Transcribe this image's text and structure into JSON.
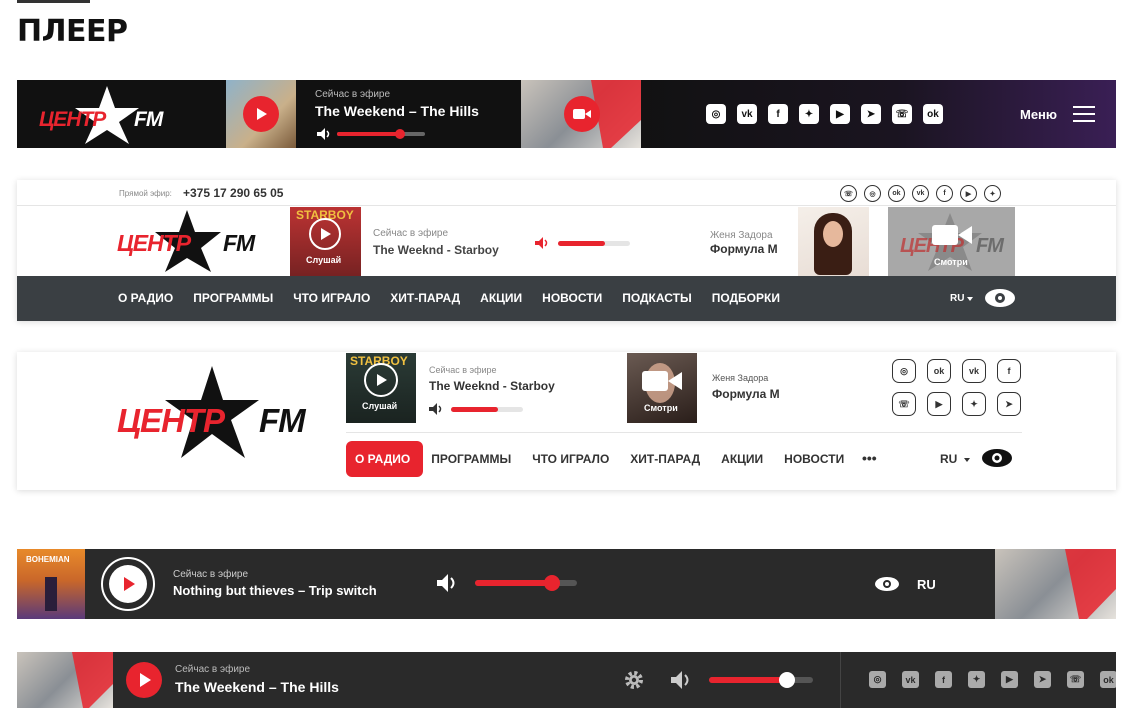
{
  "page": {
    "title": "ПЛЕЕР"
  },
  "colors": {
    "accent": "#e8242e",
    "dark": "#1c1c1c",
    "nav": "#3a3f43"
  },
  "logo": {
    "word1": "ЦЕНТР",
    "word2": "FM"
  },
  "v1": {
    "now_label": "Сейчас в эфире",
    "track": "The Weekend – The Hills",
    "volume": 0.72,
    "menu_label": "Меню",
    "social_icons": [
      "instagram-icon",
      "vk-icon",
      "facebook-icon",
      "twitter-icon",
      "youtube-icon",
      "telegram-icon",
      "viber-icon",
      "odnoklassniki-icon"
    ]
  },
  "v2": {
    "live_label": "Прямой эфир:",
    "phone": "+375 17 290 65 05",
    "album_title": "STARBOY",
    "listen_label": "Слушай",
    "now_label": "Сейчас в эфире",
    "track": "The Weeknd - Starboy",
    "volume": 0.65,
    "host_name": "Женя Задора",
    "show_name": "Формула М",
    "watch_label": "Смотри",
    "nav": [
      "О РАДИО",
      "ПРОГРАММЫ",
      "ЧТО ИГРАЛО",
      "ХИТ-ПАРАД",
      "АКЦИИ",
      "НОВОСТИ",
      "ПОДКАСТЫ",
      "ПОДБОРКИ"
    ],
    "lang": "RU"
  },
  "v3": {
    "album_title": "STARBOY",
    "listen_label": "Слушай",
    "now_label": "Сейчас в эфире",
    "track": "The Weeknd - Starboy",
    "volume": 0.65,
    "watch_label": "Смотри",
    "host_name": "Женя Задора",
    "show_name": "Формула М",
    "nav": [
      "О РАДИО",
      "ПРОГРАММЫ",
      "ЧТО ИГРАЛО",
      "ХИТ-ПАРАД",
      "АКЦИИ",
      "НОВОСТИ"
    ],
    "more": "•••",
    "lang": "RU"
  },
  "v4": {
    "album_title": "BOHEMIAN",
    "now_label": "Сейчас в эфире",
    "track": "Nothing but thieves – Trip switch",
    "volume": 0.75,
    "lang": "RU"
  },
  "v5": {
    "now_label": "Сейчас в эфире",
    "track": "The Weekend – The Hills",
    "volume": 0.75
  }
}
